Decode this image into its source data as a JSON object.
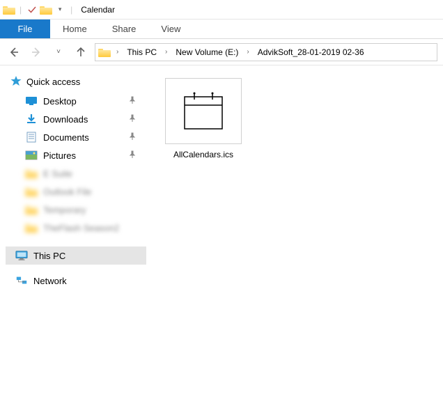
{
  "window": {
    "title": "Calendar"
  },
  "ribbon": {
    "file": "File",
    "tabs": [
      "Home",
      "Share",
      "View"
    ]
  },
  "breadcrumb": {
    "items": [
      "This PC",
      "New Volume (E:)",
      "AdvikSoft_28-01-2019 02-36"
    ]
  },
  "sidebar": {
    "quick_access": "Quick access",
    "items": [
      {
        "label": "Desktop",
        "pinned": true
      },
      {
        "label": "Downloads",
        "pinned": true
      },
      {
        "label": "Documents",
        "pinned": true
      },
      {
        "label": "Pictures",
        "pinned": true
      }
    ],
    "blurred_items": [
      "E Suite",
      "Outlook File",
      "Temporary",
      "TheFlash Season2"
    ],
    "this_pc": "This PC",
    "network": "Network"
  },
  "files": [
    {
      "name": "AllCalendars.ics"
    }
  ]
}
